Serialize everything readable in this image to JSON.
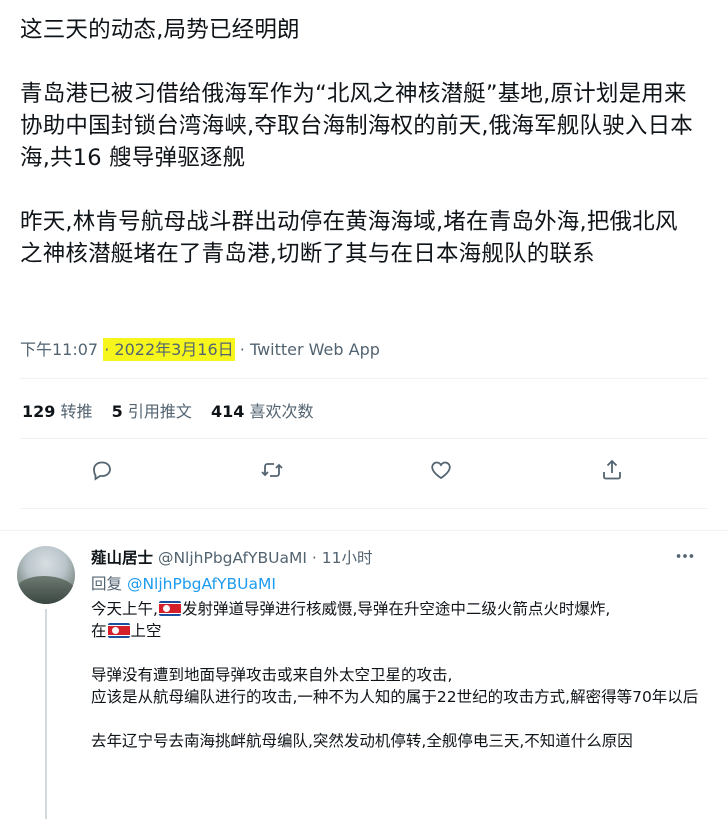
{
  "tweet": {
    "paragraphs": [
      "这三天的动态,局势已经明朗",
      "青岛港已被习借给俄海军作为“北风之神核潜艇”基地,原计划是用来协助中国封锁台湾海峡,夺取台海制海权的前天,俄海军舰队驶入日本海,共16 艘导弹驱逐舰",
      "昨天,林肯号航母战斗群出动停在黄海海域,堵在青岛外海,把俄北风之神核潜艇堵在了青岛港,切断了其与在日本海舰队的联系"
    ],
    "time": "下午11:07",
    "separator": "·",
    "date": "2022年3月16日",
    "app": "Twitter Web App",
    "highlight_color": "#f7f61c"
  },
  "stats": {
    "retweets_count": "129",
    "retweets_label": "转推",
    "quotes_count": "5",
    "quotes_label": "引用推文",
    "likes_count": "414",
    "likes_label": "喜欢次数"
  },
  "actions": [
    {
      "name": "reply-icon"
    },
    {
      "name": "retweet-icon"
    },
    {
      "name": "like-icon"
    },
    {
      "name": "share-icon"
    }
  ],
  "reply": {
    "display_name": "薤山居士",
    "handle": "@NljhPbgAfYBUaMI",
    "separator": "·",
    "time": "11小时",
    "reply_to_label": "回复",
    "reply_to_handle": "@NljhPbgAfYBUaMI",
    "line1_a": "今天上午,",
    "line1_b": "发射弹道导弹进行核威慑,导弹在升空途中二级火箭点火时爆炸,",
    "line2_a": "在",
    "line2_b": "上空",
    "para2": "导弹没有遭到地面导弹攻击或来自外太空卫星的攻击,",
    "para2b": "应该是从航母编队进行的攻击,一种不为人知的属于22世纪的攻击方式,解密得等70年以后",
    "para3": "去年辽宁号去南海挑衅航母编队,突然发动机停转,全舰停电三天,不知道什么原因",
    "flag_icon": "north-korea-flag-icon"
  },
  "colors": {
    "link": "#1d9bf0",
    "muted": "#536471",
    "text": "#0f1419"
  }
}
